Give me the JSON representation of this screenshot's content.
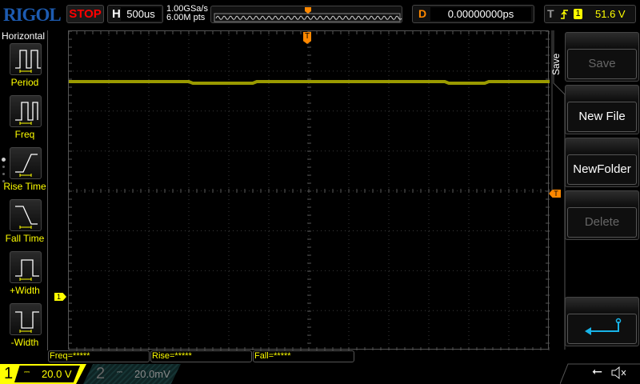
{
  "header": {
    "logo": "RIGOL",
    "run_state": "STOP",
    "timebase_label": "H",
    "timebase": "500us",
    "sample_rate": "1.00GSa/s",
    "memory_depth": "6.00M pts",
    "delay_label": "D",
    "delay": "0.00000000ps",
    "trigger_label": "T",
    "trigger_source": "1",
    "trigger_level": "51.6 V",
    "trigger_slope": "rising-edge-icon"
  },
  "sidebar": {
    "title": "Horizontal",
    "items": [
      {
        "label": "Period"
      },
      {
        "label": "Freq"
      },
      {
        "label": "Rise Time"
      },
      {
        "label": "Fall Time"
      },
      {
        "label": "+Width"
      },
      {
        "label": "-Width"
      }
    ]
  },
  "plot": {
    "trigger_marker": "T",
    "channel_marker": "1",
    "trace_color": "#9a9a00"
  },
  "right_panel": {
    "menu_title": "Save",
    "buttons": [
      {
        "label": "Save",
        "enabled": false
      },
      {
        "label": "New File",
        "enabled": true
      },
      {
        "label": "NewFolder",
        "enabled": true
      },
      {
        "label": "Delete",
        "enabled": false
      }
    ],
    "back_icon": "return-arrow-icon",
    "back_color": "#18b4e8"
  },
  "measurements": [
    {
      "text": "Freq=*****"
    },
    {
      "text": "Rise=*****"
    },
    {
      "text": "Fall=*****"
    }
  ],
  "channels": [
    {
      "num": "1",
      "coupling": "DC",
      "scale": "20.0 V",
      "color": "#ffff00"
    },
    {
      "num": "2",
      "coupling": "DC",
      "scale": "20.0mV",
      "color": "#1a3a3a"
    }
  ],
  "status_icons": [
    "usb-icon",
    "speaker-muted-icon"
  ]
}
